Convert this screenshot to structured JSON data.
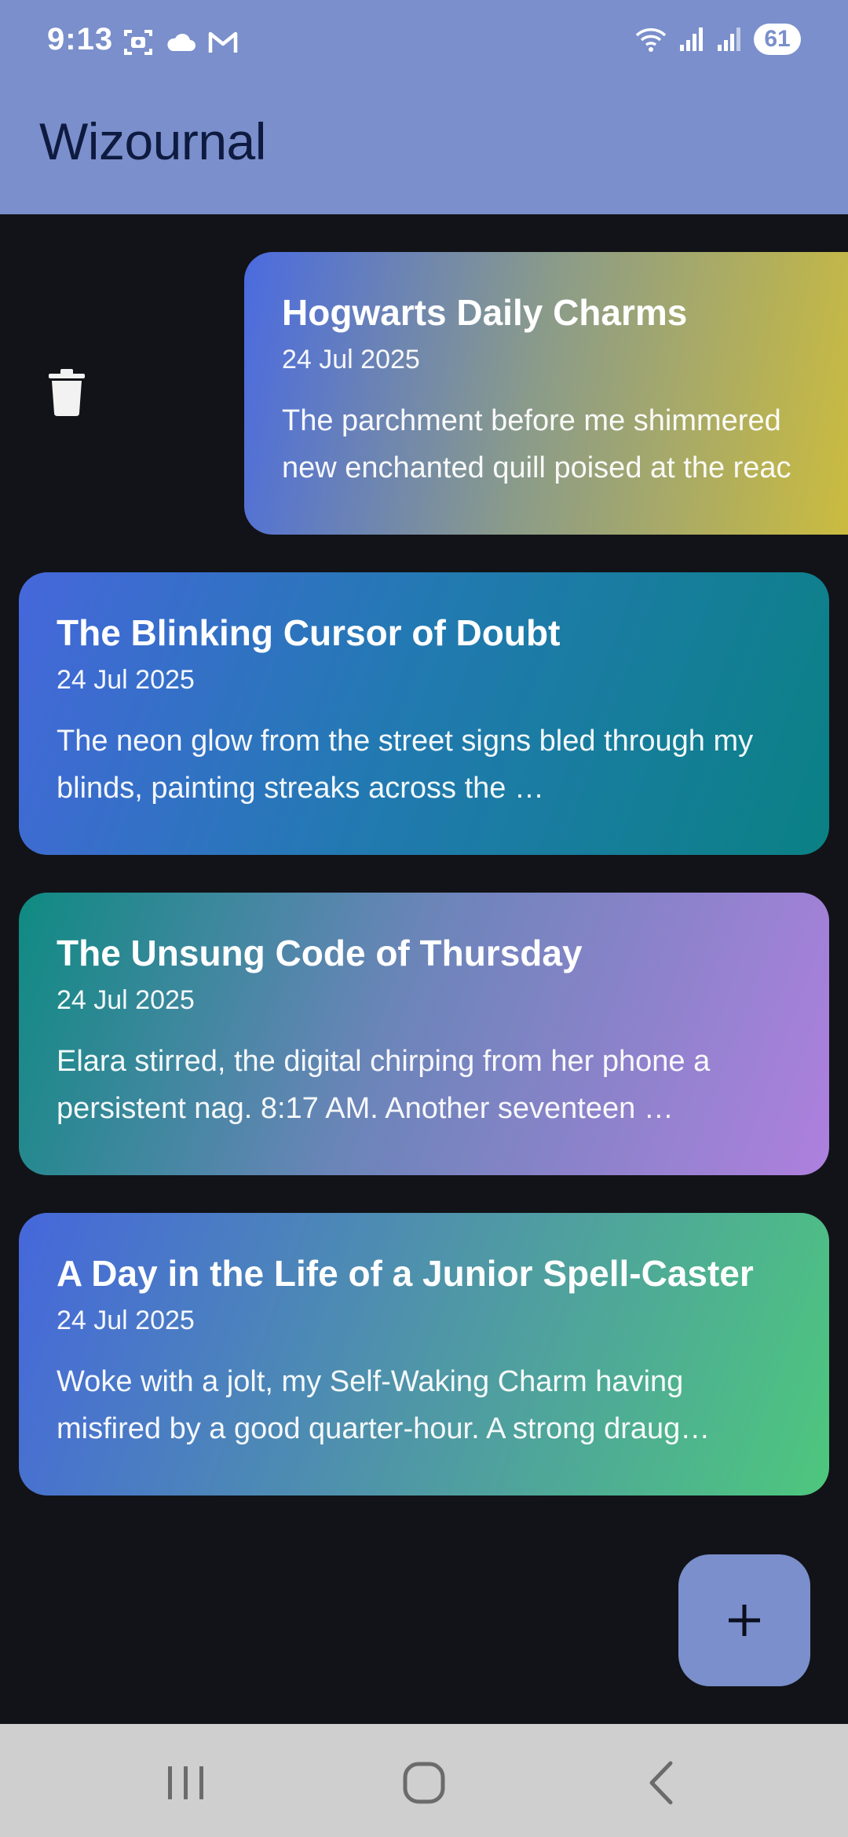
{
  "status_bar": {
    "time": "9:13",
    "battery": "61",
    "left_icons": [
      "screenshot-icon",
      "cloud-icon",
      "gmail-icon"
    ],
    "right_icons": [
      "wifi-icon",
      "signal-icon",
      "signal-icon"
    ]
  },
  "app_bar": {
    "title": "Wizournal",
    "color": "#7a8fcb"
  },
  "entries": [
    {
      "title": "Hogwarts Daily Charms",
      "date": "24 Jul 2025",
      "excerpt_line1": "The parchment before me shimmered",
      "excerpt_line2": "new enchanted quill poised at the reac",
      "swiped": true
    },
    {
      "title": "The Blinking Cursor of Doubt",
      "date": "24 Jul 2025",
      "excerpt": "The neon glow from the street signs bled through my blinds, painting streaks across the …"
    },
    {
      "title": "The Unsung Code of Thursday",
      "date": "24 Jul 2025",
      "excerpt": "Elara stirred, the digital chirping from her phone a persistent nag. 8:17 AM. Another seventeen …"
    },
    {
      "title": "A Day in the Life of a Junior Spell-Caster",
      "date": "24 Jul 2025",
      "excerpt": "Woke with a jolt, my Self-Waking Charm having misfired by a good quarter-hour. A strong draug…"
    }
  ],
  "actions": {
    "delete_icon": "trash-icon",
    "fab_icon": "plus-icon"
  },
  "nav_bar": {
    "icons": [
      "recent-apps-icon",
      "home-icon",
      "back-icon"
    ]
  }
}
